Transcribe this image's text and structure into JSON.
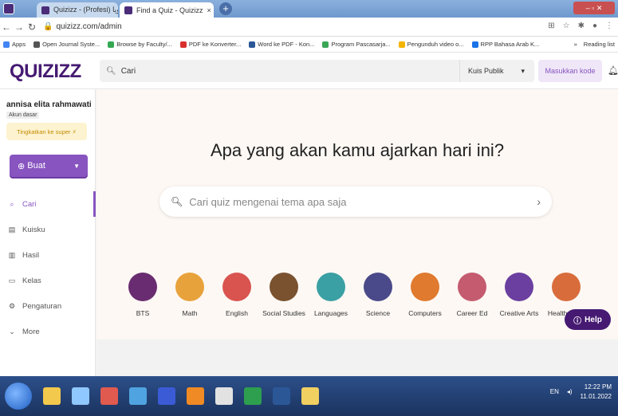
{
  "browser": {
    "tabs": [
      {
        "title": "Quizizz - (Profesi) لغويا"
      },
      {
        "title": "Find a Quiz - Quizizz"
      }
    ],
    "new_tab": "+",
    "url": "quizizz.com/admin",
    "bookmarks": [
      {
        "label": "Apps",
        "color": "#4285f4"
      },
      {
        "label": "Open Journal Syste...",
        "color": "#555555"
      },
      {
        "label": "Browse by Faculty/...",
        "color": "#34a853"
      },
      {
        "label": "PDF ke Konverter...",
        "color": "#d9302e"
      },
      {
        "label": "Word ke PDF - Kon...",
        "color": "#2b5797"
      },
      {
        "label": "Program Pascasarja...",
        "color": "#3aa757"
      },
      {
        "label": "Pengunduh video o...",
        "color": "#f4b400"
      },
      {
        "label": "RPP Bahasa Arab K...",
        "color": "#1a73e8"
      }
    ],
    "reading_list": "Reading list"
  },
  "app": {
    "logo": "QUIZIZZ",
    "search": {
      "value": "Cari"
    },
    "filter": {
      "selected": "Kuis Publik"
    },
    "join_button": "Masukkan kode",
    "sidebar": {
      "username": "annisa elita rahmawati",
      "account_type": "Akun dasar",
      "upgrade": "Tingkatkan ke super",
      "create_button": "Buat",
      "items": [
        {
          "label": "Cari",
          "icon": "search-icon",
          "active": true
        },
        {
          "label": "Kuisku",
          "icon": "folder-icon",
          "active": false
        },
        {
          "label": "Hasil",
          "icon": "chart-icon",
          "active": false
        },
        {
          "label": "Kelas",
          "icon": "class-icon",
          "active": false
        },
        {
          "label": "Pengaturan",
          "icon": "gear-icon",
          "active": false
        },
        {
          "label": "More",
          "icon": "chevron-down-icon",
          "active": false
        }
      ]
    },
    "main": {
      "headline": "Apa yang akan kamu ajarkan hari ini?",
      "search_placeholder": "Cari quiz mengenai tema apa saja",
      "categories": [
        {
          "label": "BTS",
          "color": "#6a2c70"
        },
        {
          "label": "Math",
          "color": "#e8a23b"
        },
        {
          "label": "English",
          "color": "#d9534f"
        },
        {
          "label": "Social Studies",
          "color": "#7a5230"
        },
        {
          "label": "Languages",
          "color": "#3aa0a3"
        },
        {
          "label": "Science",
          "color": "#4a4a8a"
        },
        {
          "label": "Computers",
          "color": "#e07a2f"
        },
        {
          "label": "Career Ed",
          "color": "#c45b6e"
        },
        {
          "label": "Creative Arts",
          "color": "#6b3fa0"
        },
        {
          "label": "Health & PE",
          "color": "#d96c3b"
        }
      ]
    },
    "help_button": "Help"
  },
  "taskbar": {
    "language": "EN",
    "time": "12:22 PM",
    "date": "11.01.2022"
  }
}
